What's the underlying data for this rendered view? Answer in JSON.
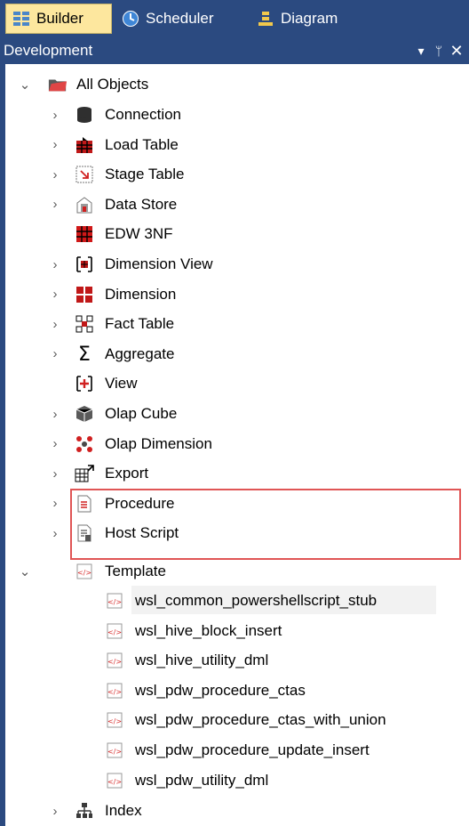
{
  "tabs": [
    {
      "label": "Builder",
      "icon": "builder-grid-icon"
    },
    {
      "label": "Scheduler",
      "icon": "scheduler-clock-icon"
    },
    {
      "label": "Diagram",
      "icon": "diagram-icon"
    }
  ],
  "panel": {
    "title": "Development",
    "pin_glyph": "▾ ⊥",
    "close_glyph": "✕"
  },
  "tree": {
    "root": {
      "label": "All Objects",
      "icon": "folder-open-icon"
    },
    "items": [
      {
        "label": "Connection",
        "icon": "connection-icon",
        "expandable": true
      },
      {
        "label": "Load Table",
        "icon": "load-table-icon",
        "expandable": true
      },
      {
        "label": "Stage Table",
        "icon": "stage-table-icon",
        "expandable": true
      },
      {
        "label": "Data Store",
        "icon": "data-store-icon",
        "expandable": true
      },
      {
        "label": "EDW 3NF",
        "icon": "edw-3nf-icon",
        "expandable": false
      },
      {
        "label": "Dimension View",
        "icon": "dimension-view-icon",
        "expandable": true
      },
      {
        "label": "Dimension",
        "icon": "dimension-icon",
        "expandable": true
      },
      {
        "label": "Fact Table",
        "icon": "fact-table-icon",
        "expandable": true
      },
      {
        "label": "Aggregate",
        "icon": "aggregate-sigma-icon",
        "expandable": true
      },
      {
        "label": "View",
        "icon": "view-icon",
        "expandable": false
      },
      {
        "label": "Olap Cube",
        "icon": "olap-cube-icon",
        "expandable": true
      },
      {
        "label": "Olap Dimension",
        "icon": "olap-dimension-icon",
        "expandable": true
      },
      {
        "label": "Export",
        "icon": "export-icon",
        "expandable": true
      },
      {
        "label": "Procedure",
        "icon": "procedure-icon",
        "expandable": true
      },
      {
        "label": "Host Script",
        "icon": "host-script-icon",
        "expandable": true
      }
    ],
    "template": {
      "label": "Template",
      "icon": "template-icon",
      "children": [
        {
          "label": "wsl_common_powershellscript_stub",
          "selected": true
        },
        {
          "label": "wsl_hive_block_insert"
        },
        {
          "label": "wsl_hive_utility_dml"
        },
        {
          "label": "wsl_pdw_procedure_ctas"
        },
        {
          "label": "wsl_pdw_procedure_ctas_with_union"
        },
        {
          "label": "wsl_pdw_procedure_update_insert"
        },
        {
          "label": "wsl_pdw_utility_dml"
        }
      ]
    },
    "index": {
      "label": "Index",
      "icon": "index-icon"
    }
  },
  "colors": {
    "panel_blue": "#2b4a80",
    "active_tab": "#fde79e",
    "highlight_red": "#e05555",
    "selection": "#f2f2f2"
  }
}
